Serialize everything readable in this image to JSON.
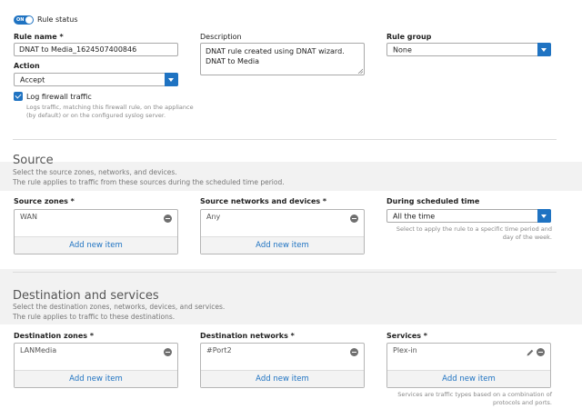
{
  "rule": {
    "status_label": "Rule status",
    "toggle_text": "ON",
    "name_label": "Rule name *",
    "name_value": "DNAT to Media_1624507400846",
    "description_label": "Description",
    "description_value": "DNAT rule created using DNAT wizard. DNAT to Media",
    "group_label": "Rule group",
    "group_value": "None",
    "action_label": "Action",
    "action_value": "Accept",
    "log_label": "Log firewall traffic",
    "log_checked": true,
    "log_hint": "Logs traffic, matching this firewall rule, on the appliance (by default) or on the configured syslog server."
  },
  "source": {
    "title": "Source",
    "sub1": "Select the source zones, networks, and devices.",
    "sub2": "The rule applies to traffic from these sources during the scheduled time period.",
    "zones_label": "Source zones *",
    "zones_item": "WAN",
    "networks_label": "Source networks and devices *",
    "networks_item": "Any",
    "schedule_label": "During scheduled time",
    "schedule_value": "All the time",
    "schedule_hint": "Select to apply the rule to a specific time period and day of the week.",
    "add_label": "Add new item"
  },
  "destination": {
    "title": "Destination and services",
    "sub1": "Select the destination zones, networks, devices, and services.",
    "sub2": "The rule applies to traffic to these destinations.",
    "zones_label": "Destination zones *",
    "zones_item": "LANMedia",
    "networks_label": "Destination networks *",
    "networks_item": "#Port2",
    "services_label": "Services *",
    "services_item": "Plex-in",
    "services_hint": "Services are traffic types based on a combination of protocols and ports.",
    "add_label": "Add new item"
  },
  "colors": {
    "accent": "#1f73c2",
    "panel": "#ffffff",
    "background": "#f2f2f2"
  }
}
